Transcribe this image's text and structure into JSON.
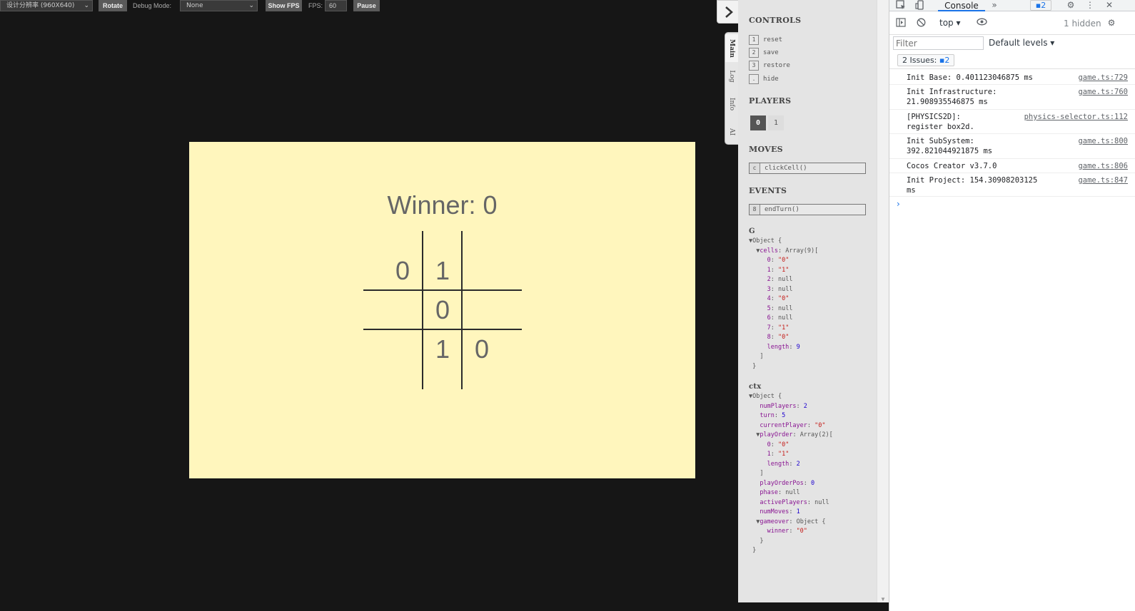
{
  "toolbar": {
    "resolution": "设计分辨率 (960X640)",
    "rotate": "Rotate",
    "debug_label": "Debug Mode:",
    "debug_value": "None",
    "show_fps": "Show FPS",
    "fps_label": "FPS:",
    "fps_value": "60",
    "pause": "Pause"
  },
  "game": {
    "winner_text": "Winner: 0",
    "cells": [
      "0",
      "1",
      "",
      "",
      "0",
      "",
      "",
      "1",
      "0"
    ]
  },
  "side_tabs": [
    "Main",
    "Log",
    "Info",
    "AI"
  ],
  "debug_panel": {
    "controls_title": "CONTROLS",
    "controls": [
      {
        "key": "1",
        "label": "reset"
      },
      {
        "key": "2",
        "label": "save"
      },
      {
        "key": "3",
        "label": "restore"
      },
      {
        "key": ".",
        "label": "hide"
      }
    ],
    "players_title": "PLAYERS",
    "players": [
      "0",
      "1"
    ],
    "moves_title": "MOVES",
    "move": {
      "key": "c",
      "label": "clickCell()"
    },
    "events_title": "EVENTS",
    "event": {
      "key": "8",
      "label": "endTurn()"
    },
    "g_title": "G",
    "ctx_title": "ctx"
  },
  "devtools": {
    "tab_console": "Console",
    "issue_count": "2",
    "context": "top",
    "hidden": "1 hidden",
    "filter_placeholder": "Filter",
    "levels": "Default levels",
    "issues_label": "2 Issues:",
    "issues_count": "2",
    "logs": [
      {
        "msg": "Init Base: 0.401123046875 ms",
        "src": "game.ts:729"
      },
      {
        "msg": "Init Infrastructure:\n21.908935546875 ms",
        "src": "game.ts:760"
      },
      {
        "msg": "[PHYSICS2D]:\nregister box2d.",
        "src": "physics-selector.ts:112"
      },
      {
        "msg": "Init SubSystem:\n392.821044921875 ms",
        "src": "game.ts:800"
      },
      {
        "msg": "Cocos Creator v3.7.0",
        "src": "game.ts:806"
      },
      {
        "msg": "Init Project: 154.30908203125\nms",
        "src": "game.ts:847"
      }
    ]
  }
}
